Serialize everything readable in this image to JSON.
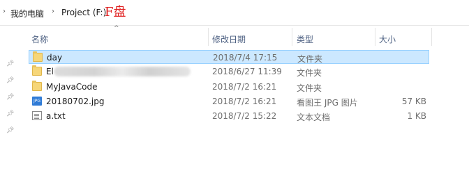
{
  "breadcrumb": {
    "items": [
      "我的电脑",
      "Project (F:)"
    ],
    "annotation": "F盘"
  },
  "columns": {
    "name": "名称",
    "date": "修改日期",
    "type": "类型",
    "size": "大小"
  },
  "files": [
    {
      "name": "day",
      "date": "2018/7/4 17:15",
      "type": "文件夹",
      "size": "",
      "icon": "folder-icon",
      "selected": true
    },
    {
      "name": "El",
      "date": "2018/6/27 11:39",
      "type": "文件夹",
      "size": "",
      "icon": "folder-icon",
      "selected": false
    },
    {
      "name": "MyJavaCode",
      "date": "2018/7/2 16:21",
      "type": "文件夹",
      "size": "",
      "icon": "folder-icon",
      "selected": false
    },
    {
      "name": "20180702.jpg",
      "date": "2018/7/2 16:21",
      "type": "看图王 JPG 图片",
      "size": "57 KB",
      "icon": "jpg-icon",
      "selected": false
    },
    {
      "name": "a.txt",
      "date": "2018/7/2 15:22",
      "type": "文本文档",
      "size": "1 KB",
      "icon": "txt-icon",
      "selected": false
    }
  ],
  "colors": {
    "selection": "#cce8ff",
    "selection_border": "#99d1ff",
    "annotation": "#e02020",
    "header_text": "#4d6082"
  }
}
